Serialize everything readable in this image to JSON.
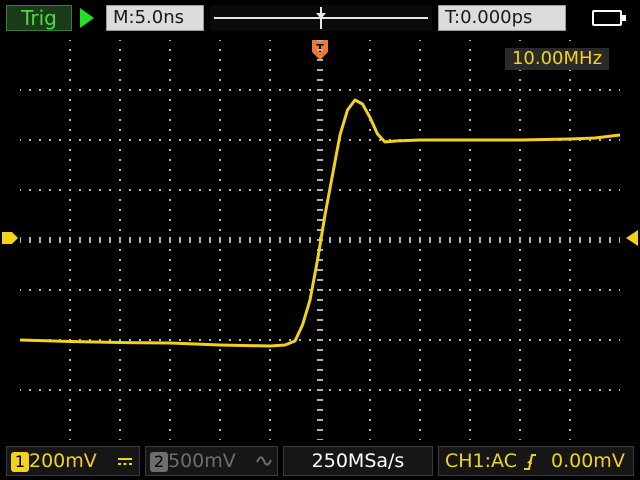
{
  "top_bar": {
    "trigger_status": "Trig",
    "run_state_icon": "play-icon",
    "timebase": "M:5.0ns",
    "trigger_time": "T:0.000ps",
    "battery_icon": "battery-icon"
  },
  "display": {
    "frequency": "10.00MHz",
    "grid": {
      "horizontal_divisions": 12,
      "vertical_divisions": 8
    },
    "trace_color": "#f2d21a",
    "trigger_position_marker": "T",
    "trace": {
      "description_units": "divisions",
      "points": [
        [
          0.0,
          -2.0
        ],
        [
          1.0,
          -2.03
        ],
        [
          2.0,
          -2.05
        ],
        [
          3.0,
          -2.06
        ],
        [
          4.0,
          -2.1
        ],
        [
          5.0,
          -2.12
        ],
        [
          5.3,
          -2.1
        ],
        [
          5.5,
          -2.02
        ],
        [
          5.65,
          -1.7
        ],
        [
          5.8,
          -1.2
        ],
        [
          5.95,
          -0.4
        ],
        [
          6.1,
          0.5
        ],
        [
          6.25,
          1.3
        ],
        [
          6.4,
          2.1
        ],
        [
          6.55,
          2.6
        ],
        [
          6.7,
          2.8
        ],
        [
          6.85,
          2.72
        ],
        [
          7.0,
          2.45
        ],
        [
          7.15,
          2.12
        ],
        [
          7.3,
          1.96
        ],
        [
          7.5,
          1.98
        ],
        [
          8.0,
          2.0
        ],
        [
          9.0,
          2.0
        ],
        [
          10.0,
          2.0
        ],
        [
          11.0,
          2.02
        ],
        [
          11.5,
          2.04
        ],
        [
          12.0,
          2.1
        ]
      ]
    }
  },
  "bottom_bar": {
    "ch1": {
      "badge": "1",
      "scale": "200mV",
      "coupling_icon": "dc-coupling-icon"
    },
    "ch2": {
      "badge": "2",
      "scale": "500mV",
      "coupling_icon": "ac-coupling-icon"
    },
    "sample_rate": "250MSa/s",
    "trigger": {
      "source": "CH1:AC",
      "edge_icon": "rising-edge-icon",
      "level": "0.00mV"
    }
  },
  "colors": {
    "ch1": "#f2d21a",
    "ch2_inactive": "#6e6e6e",
    "trigger_marker": "#f07830",
    "run_state": "#22e222",
    "trig_status_text": "#4cdc3c",
    "grid_dots": "#b4b4b4"
  }
}
